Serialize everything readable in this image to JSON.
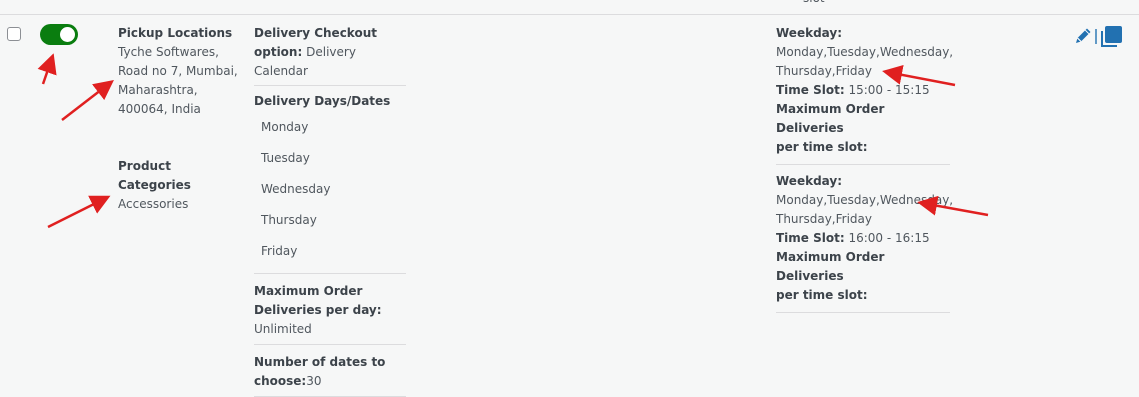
{
  "header": {
    "fragment": "slot"
  },
  "row": {
    "pickup": {
      "label": "Pickup Locations",
      "lines": [
        "Tyche Softwares,",
        "Road no 7, Mumbai,",
        "Maharashtra,",
        "400064, India"
      ]
    },
    "categories": {
      "label": "Product Categories",
      "value": "Accessories"
    },
    "checkout": {
      "label": "Delivery Checkout",
      "label2": "option:",
      "value": "Delivery Calendar"
    },
    "days": {
      "label": "Delivery Days/Dates",
      "items": [
        "Monday",
        "Tuesday",
        "Wednesday",
        "Thursday",
        "Friday"
      ]
    },
    "max_per_day": {
      "label1": "Maximum Order",
      "label2": "Deliveries per day:",
      "value": "Unlimited"
    },
    "num_dates": {
      "label1": "Number of dates to",
      "label2": "choose:",
      "value": "30"
    },
    "slots": [
      {
        "weekday_label": "Weekday:",
        "weekday_lines": [
          "Monday,Tuesday,Wednesday,",
          "Thursday,Friday"
        ],
        "time_label": "Time Slot:",
        "time_value": "15:00 - 15:15",
        "max_label1": "Maximum Order Deliveries",
        "max_label2": "per time slot:"
      },
      {
        "weekday_label": "Weekday:",
        "weekday_lines": [
          "Monday,Tuesday,Wednesday,",
          "Thursday,Friday"
        ],
        "time_label": "Time Slot:",
        "time_value": "16:00 - 16:15",
        "max_label1": "Maximum Order Deliveries",
        "max_label2": "per time slot:"
      }
    ]
  },
  "icons": {
    "edit": "pencil-icon",
    "copy": "copy-icon",
    "annotations": "red-arrow",
    "toggle_on_color": "#0a7d0f",
    "icon_color": "#2271b1",
    "arrow_color": "#e02020"
  }
}
